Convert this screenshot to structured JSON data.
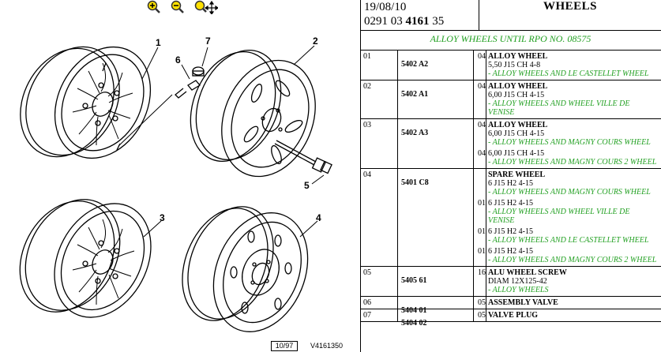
{
  "toolbar": {
    "zoom_in_icon": "zoom-in-icon",
    "zoom_out_icon": "zoom-out-icon",
    "zoom_move_icon": "zoom-move-icon"
  },
  "illustration": {
    "callouts": [
      "1",
      "2",
      "3",
      "4",
      "5",
      "6",
      "7"
    ],
    "plate_number": "10/97",
    "plate_ref": "V4161350"
  },
  "header": {
    "date": "19/08/10",
    "code_prefix": "0291 03 ",
    "code_bold": "4161",
    "code_suffix": " 35",
    "title": "WHEELS"
  },
  "subtitle": "ALLOY WHEELS UNTIL RPO NO. 08575",
  "rows": [
    {
      "idx": "01",
      "ref": "5402 A2",
      "name": "ALLOY WHEEL",
      "lines": [
        {
          "qty": "04",
          "spec": "5,50 J15 CH 4-8",
          "note": "- ALLOY WHEELS AND LE CASTELLET WHEEL"
        }
      ]
    },
    {
      "idx": "02",
      "ref": "5402 A1",
      "name": "ALLOY WHEEL",
      "lines": [
        {
          "qty": "04",
          "spec": "6,00 J15 CH 4-15",
          "note": "- ALLOY WHEELS AND WHEEL VILLE DE VENISE"
        }
      ]
    },
    {
      "idx": "03",
      "ref": "5402 A3",
      "name": "ALLOY WHEEL",
      "lines": [
        {
          "qty": "04",
          "spec": "6,00 J15 CH 4-15",
          "note": "- ALLOY WHEELS AND MAGNY COURS WHEEL"
        },
        {
          "qty": "04",
          "spec": "6,00 J15 CH 4-15",
          "note": "- ALLOY WHEELS AND MAGNY COURS 2 WHEEL"
        }
      ]
    },
    {
      "idx": "04",
      "ref": "5401 C8",
      "name": "SPARE WHEEL",
      "lines": [
        {
          "qty": "",
          "spec": "6 J15 H2 4-15",
          "note": "- ALLOY WHEELS AND MAGNY COURS WHEEL"
        },
        {
          "qty": "01",
          "spec": "6 J15 H2 4-15",
          "note": "- ALLOY WHEELS AND WHEEL VILLE DE VENISE"
        },
        {
          "qty": "01",
          "spec": "6 J15 H2 4-15",
          "note": "- ALLOY WHEELS AND LE CASTELLET WHEEL"
        },
        {
          "qty": "01",
          "spec": "6 J15 H2 4-15",
          "note": "- ALLOY WHEELS AND MAGNY COURS 2 WHEEL"
        }
      ]
    },
    {
      "idx": "05",
      "ref": "5405 61",
      "name": "ALU WHEEL SCREW",
      "lines": [
        {
          "qty": "16",
          "spec": "DIAM 12X125-42",
          "note": "- ALLOY WHEELS"
        }
      ]
    },
    {
      "idx": "06",
      "ref": "5404 01",
      "name": "ASSEMBLY VALVE",
      "lines": [
        {
          "qty": "05",
          "spec": "",
          "note": ""
        }
      ]
    },
    {
      "idx": "07",
      "ref": "5404 02",
      "name": "VALVE PLUG",
      "lines": [
        {
          "qty": "05",
          "spec": "",
          "note": ""
        }
      ]
    }
  ]
}
